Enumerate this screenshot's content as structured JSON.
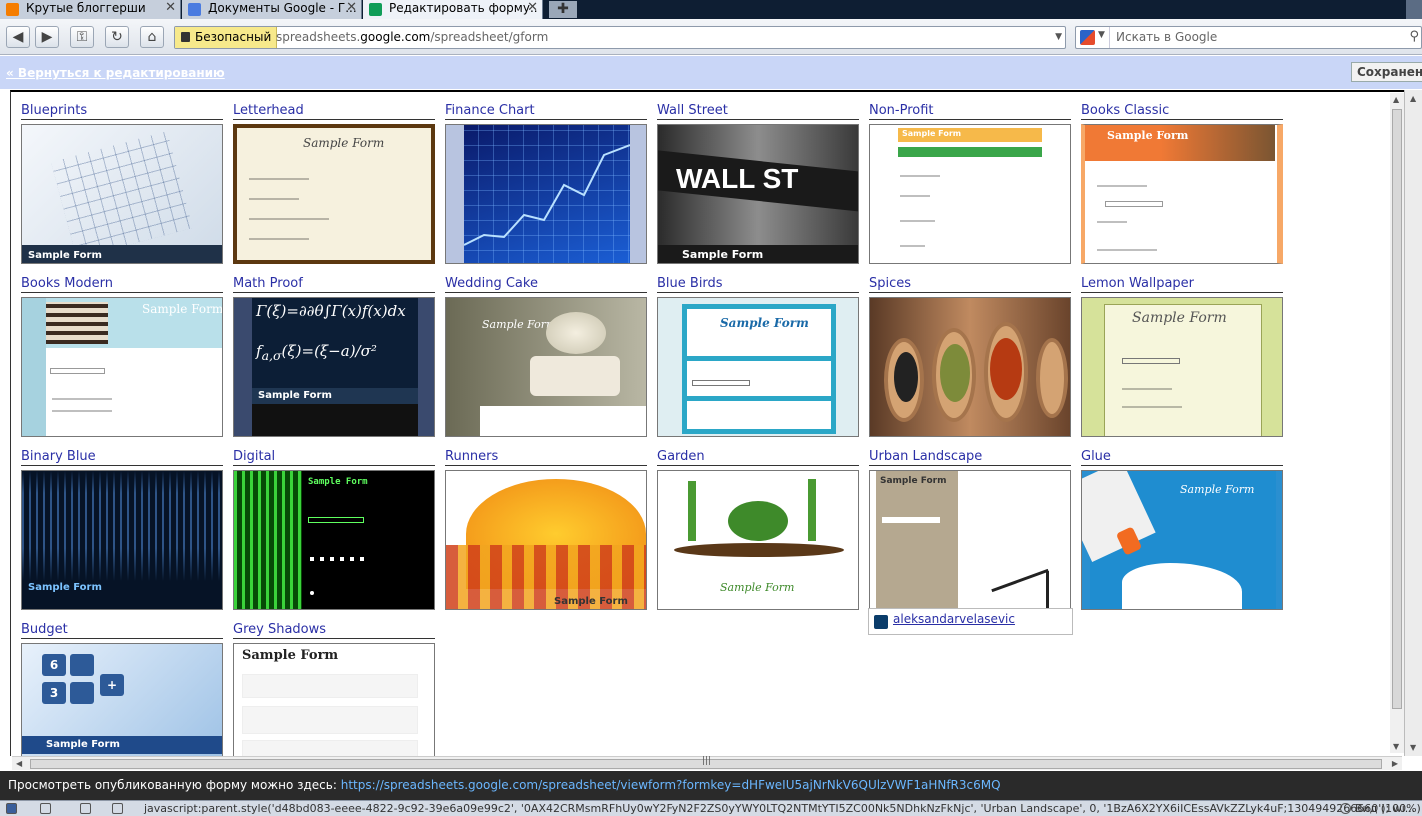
{
  "tabs": [
    {
      "title": "Крутые блоггерши",
      "color": "#f57d00"
    },
    {
      "title": "Документы Google - Г...",
      "color": "#4a7be0"
    },
    {
      "title": "Редактировать форму...",
      "color": "#0f9d58"
    }
  ],
  "navbar": {
    "secure_label": "Безопасный",
    "url_prefix": "spreadsheets.",
    "url_domain": "google.com",
    "url_path": "/spreadsheet/gform",
    "search_placeholder": "Искать в Google"
  },
  "editbar": {
    "back_label": "« Вернуться к редактированию",
    "saved_label": "Сохранено"
  },
  "themes": [
    {
      "name": "Blueprints",
      "thumb_label": "Sample Form"
    },
    {
      "name": "Letterhead",
      "thumb_label": "Sample Form"
    },
    {
      "name": "Finance Chart",
      "thumb_label": ""
    },
    {
      "name": "Wall Street",
      "thumb_label": "Sample Form",
      "thumb_text": "WALL ST"
    },
    {
      "name": "Non-Profit",
      "thumb_label": "Sample Form"
    },
    {
      "name": "Books Classic",
      "thumb_label": "Sample Form"
    },
    {
      "name": "Books Modern",
      "thumb_label": "Sample Form"
    },
    {
      "name": "Math Proof",
      "thumb_label": "Sample Form"
    },
    {
      "name": "Wedding Cake",
      "thumb_label": "Sample Form"
    },
    {
      "name": "Blue Birds",
      "thumb_label": "Sample Form"
    },
    {
      "name": "Spices",
      "thumb_label": ""
    },
    {
      "name": "Lemon Wallpaper",
      "thumb_label": "Sample Form"
    },
    {
      "name": "Binary Blue",
      "thumb_label": "Sample Form"
    },
    {
      "name": "Digital",
      "thumb_label": "Sample Form"
    },
    {
      "name": "Runners",
      "thumb_label": "Sample Form"
    },
    {
      "name": "Garden",
      "thumb_label": "Sample Form"
    },
    {
      "name": "Urban Landscape",
      "thumb_label": "Sample Form"
    },
    {
      "name": "Glue",
      "thumb_label": "Sample Form"
    },
    {
      "name": "Budget",
      "thumb_label": "Sample Form"
    },
    {
      "name": "Grey Shadows",
      "thumb_label": "Sample Form"
    }
  ],
  "tooltip": {
    "author": "aleksandarvelasevic"
  },
  "publish": {
    "text": "Просмотреть опубликованную форму можно здесь:",
    "link": "https://spreadsheets.google.com/spreadsheet/viewform?formkey=dHFweIU5ajNrNkV6QUlzVWF1aHNfR3c6MQ"
  },
  "status": {
    "text": "javascript:parent.style('d48bd083-eeee-4822-9c92-39e6a09e99c2', '0AX42CRMsmRFhUy0wY2FyN2F2ZS0yYWY0LTQ2NTMtYTI5ZC00Nk5NDhkNzFkNjc', 'Urban Landscape', 0, '1BzA6X2YX6iICEssAVkZZLyk4uF;1304949266660'); wi...",
    "zoom": "Вид (100%)"
  }
}
